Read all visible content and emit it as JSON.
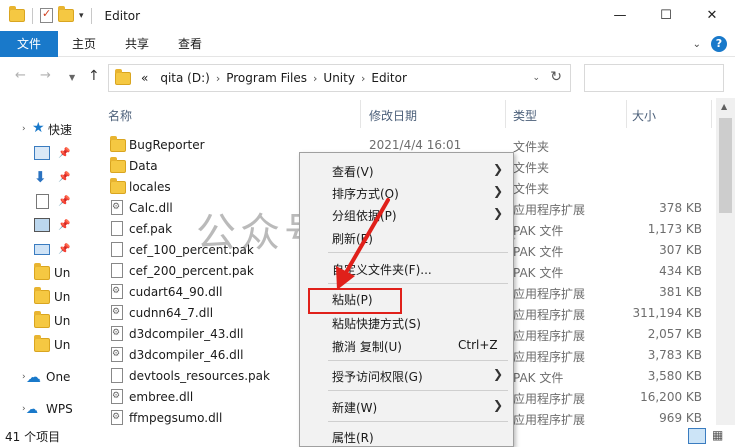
{
  "window": {
    "title": "Editor",
    "minimize": "—",
    "maximize": "☐",
    "close": "✕"
  },
  "ribbon": {
    "tabs": [
      "文件",
      "主页",
      "共享",
      "查看"
    ],
    "expand_icon": "chevron-down-icon",
    "help_icon": "?"
  },
  "address": {
    "back": "←",
    "forward": "→",
    "up": "↑",
    "overflow": "«",
    "crumbs": [
      "qita (D:)",
      "Program Files",
      "Unity",
      "Editor"
    ],
    "refresh": "↻",
    "search_placeholder": ""
  },
  "navpane": {
    "quick_access_label": "快速",
    "items": [
      "Un",
      "Un",
      "Un",
      "Un"
    ],
    "onedrive": "One",
    "wps": "WPS"
  },
  "columns": {
    "name": "名称",
    "date": "修改日期",
    "type": "类型",
    "size": "大小"
  },
  "files": [
    {
      "name": "BugReporter",
      "date": "2021/4/4 16:01",
      "type": "文件夹",
      "size": "",
      "icon": "folder-icon"
    },
    {
      "name": "Data",
      "date": "",
      "type": "文件夹",
      "size": "",
      "icon": "folder-icon"
    },
    {
      "name": "locales",
      "date": "",
      "type": "文件夹",
      "size": "",
      "icon": "folder-icon"
    },
    {
      "name": "Calc.dll",
      "date": "",
      "type": "应用程序扩展",
      "size": "378 KB",
      "icon": "dll-icon"
    },
    {
      "name": "cef.pak",
      "date": "",
      "type": "PAK 文件",
      "size": "1,173 KB",
      "icon": "file-icon"
    },
    {
      "name": "cef_100_percent.pak",
      "date": "",
      "type": "PAK 文件",
      "size": "307 KB",
      "icon": "file-icon"
    },
    {
      "name": "cef_200_percent.pak",
      "date": "",
      "type": "PAK 文件",
      "size": "434 KB",
      "icon": "file-icon"
    },
    {
      "name": "cudart64_90.dll",
      "date": "",
      "type": "应用程序扩展",
      "size": "381 KB",
      "icon": "dll-icon"
    },
    {
      "name": "cudnn64_7.dll",
      "date": "",
      "type": "应用程序扩展",
      "size": "311,194 KB",
      "icon": "dll-icon"
    },
    {
      "name": "d3dcompiler_43.dll",
      "date": "",
      "type": "应用程序扩展",
      "size": "2,057 KB",
      "icon": "dll-icon"
    },
    {
      "name": "d3dcompiler_46.dll",
      "date": "",
      "type": "应用程序扩展",
      "size": "3,783 KB",
      "icon": "dll-icon"
    },
    {
      "name": "devtools_resources.pak",
      "date": "",
      "type": "PAK 文件",
      "size": "3,580 KB",
      "icon": "file-icon"
    },
    {
      "name": "embree.dll",
      "date": "",
      "type": "应用程序扩展",
      "size": "16,200 KB",
      "icon": "dll-icon"
    },
    {
      "name": "ffmpegsumo.dll",
      "date": "",
      "type": "应用程序扩展",
      "size": "969 KB",
      "icon": "dll-icon"
    }
  ],
  "status": {
    "count": "41 个项目"
  },
  "context_menu": {
    "view": "查看(V)",
    "sort": "排序方式(O)",
    "group": "分组依据(P)",
    "refresh": "刷新(E)",
    "customize": "自定义文件夹(F)...",
    "paste": "粘贴(P)",
    "paste_shortcut": "粘贴快捷方式(S)",
    "undo": "撤消 复制(U)",
    "undo_shortcut": "Ctrl+Z",
    "give_access": "授予访问权限(G)",
    "new": "新建(W)",
    "properties": "属性(R)",
    "submenu_arrow": "❯"
  },
  "watermark": "公众号 开源神器",
  "colors": {
    "accent": "#1979ca",
    "highlight_box": "#e0201a",
    "menu_bg": "#f2f2f2"
  }
}
